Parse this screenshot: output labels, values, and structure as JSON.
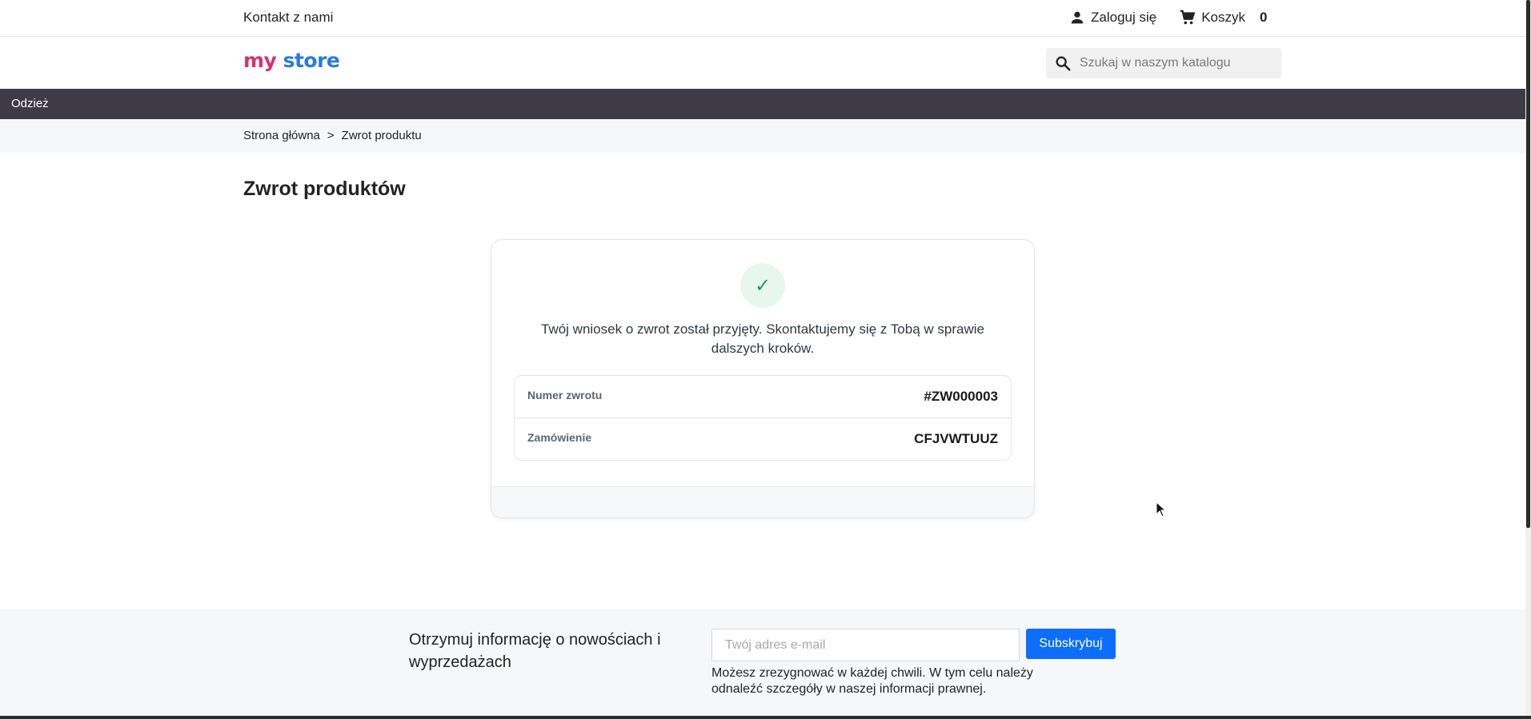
{
  "topbar": {
    "contact_label": "Kontakt z nami",
    "login_label": "Zaloguj się",
    "cart_label": "Koszyk",
    "cart_count": "0"
  },
  "header": {
    "logo": {
      "part1": "my",
      "part2": "store"
    },
    "search": {
      "placeholder": "Szukaj w naszym katalogu",
      "value": ""
    }
  },
  "nav": {
    "items": [
      {
        "label": "Odzież"
      }
    ]
  },
  "breadcrumb": {
    "items": [
      "Strona główna",
      "Zwrot produktu"
    ],
    "separator": ">"
  },
  "page": {
    "title": "Zwrot produktów"
  },
  "confirmation": {
    "icon": "check-icon",
    "check_glyph": "✓",
    "message": "Twój wniosek o zwrot został przyjęty. Skontaktujemy się z Tobą w sprawie dalszych kroków.",
    "details": [
      {
        "label": "Numer zwrotu",
        "value": "#ZW000003"
      },
      {
        "label": "Zamówienie",
        "value": "CFJVWTUUZ"
      }
    ]
  },
  "newsletter": {
    "text": "Otrzymuj informację o nowościach i wyprzedażach",
    "input_placeholder": "Twój adres e-mail",
    "input_value": "",
    "button_label": "Subskrybuj",
    "note": "Możesz zrezygnować w każdej chwili. W tym celu należy odnaleźć szczegóły w naszej informacji prawnej."
  },
  "colors": {
    "nav_bg": "#3e3b47",
    "accent_button": "#0d6efd",
    "success": "#1f9d55",
    "success_bg": "#e7f7ee"
  }
}
